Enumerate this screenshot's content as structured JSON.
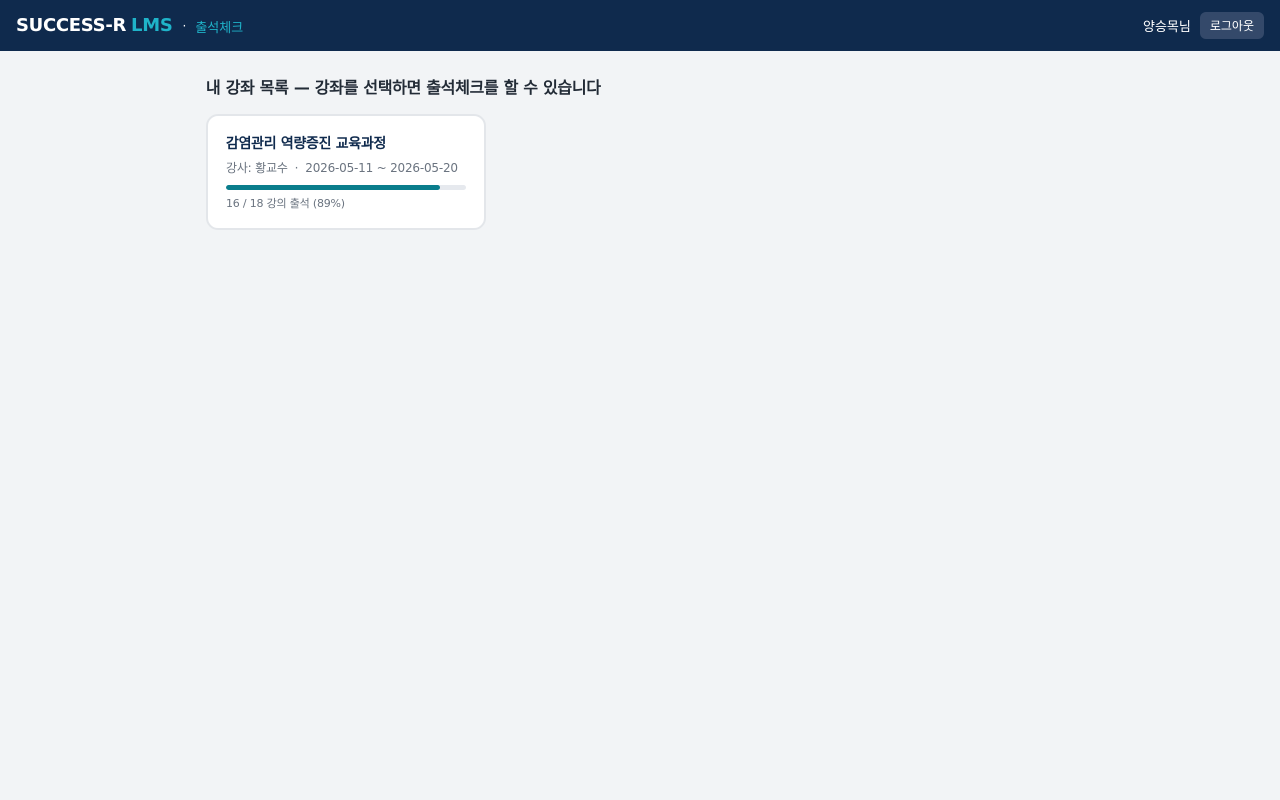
{
  "header": {
    "brand_name": "SUCCESS-R",
    "brand_accent": "LMS",
    "separator": "·",
    "section": "출석체크",
    "user_name": "양승목님",
    "logout_label": "로그아웃"
  },
  "main": {
    "title": "내 강좌 목록 — 강좌를 선택하면 출석체크를 할 수 있습니다",
    "courses": [
      {
        "title": "감염관리 역량증진 교육과정",
        "instructor": "강사: 황교수",
        "separator": "·",
        "period": "2026-05-11 ~ 2026-05-20",
        "attended": 16,
        "total": 18,
        "progress_percent": 89,
        "attendance_text": "16 / 18 강의 출석 (89%)"
      }
    ]
  },
  "colors": {
    "header_bg": "#0f2a4d",
    "accent": "#1fb3c9",
    "progress": "#0a7d8c",
    "page_bg": "#f2f4f6"
  }
}
